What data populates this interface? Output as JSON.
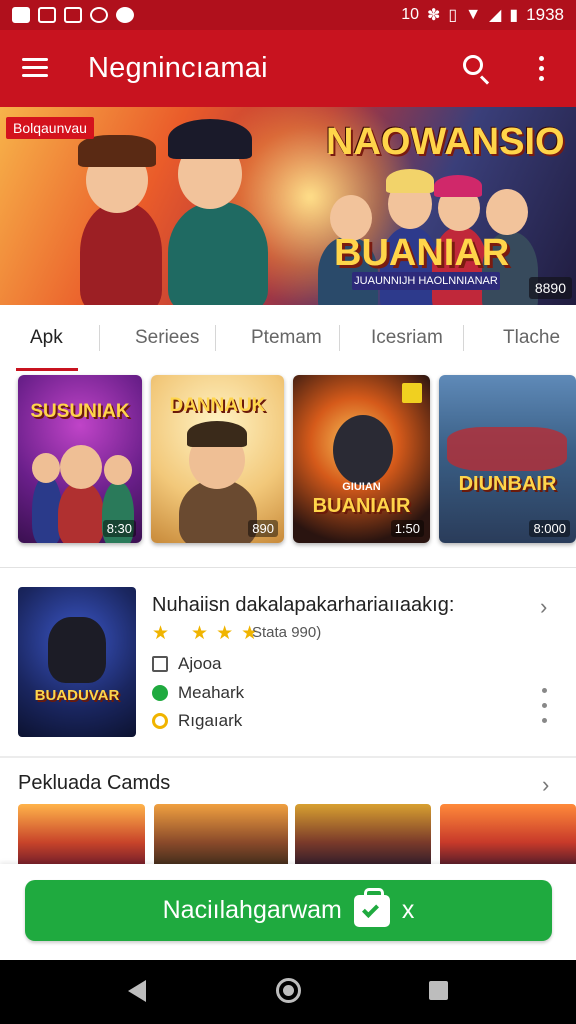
{
  "status_bar": {
    "time": "1938",
    "signal_text": "10"
  },
  "app_bar": {
    "title": "Negnincıamai"
  },
  "banner": {
    "badge": "Bolqaunvau",
    "logo": "NAOWANSIO",
    "title": "BUANIAR",
    "subtitle": "JUAUNNIJH HAOLNNIANAR",
    "count": "8890"
  },
  "tabs": [
    {
      "label": "Apk"
    },
    {
      "label": "Seriees"
    },
    {
      "label": "Ptemam"
    },
    {
      "label": "Icesriam"
    },
    {
      "label": "Tlache"
    }
  ],
  "cards": [
    {
      "title": "SUSUNIAK",
      "count": "8:30"
    },
    {
      "title": "DANNAUK",
      "count": "890"
    },
    {
      "title": "BUANIAIR",
      "subtitle": "GIUIAN",
      "count": "1:50"
    },
    {
      "title": "DIUNBAIR",
      "count": "8:000"
    }
  ],
  "featured": {
    "title": "Nuhaiisn dakalapakarhariaııaakıg:",
    "rating_text": "Stata 990)",
    "stars": 3,
    "info": [
      {
        "icon": "tag-icon",
        "text": "Ajooa"
      },
      {
        "icon": "gear-green-icon",
        "text": "Meahark"
      },
      {
        "icon": "clock-icon",
        "text": "Rıgaıark"
      }
    ],
    "thumb_title": "BUADUVAR"
  },
  "section": {
    "title": "Pekluada  Camds"
  },
  "action": {
    "label": "Naciılahgarwam",
    "suffix": "x"
  },
  "colors": {
    "brand_red": "#c8131f",
    "accent_green": "#1faa3f",
    "star": "#f0b400"
  }
}
